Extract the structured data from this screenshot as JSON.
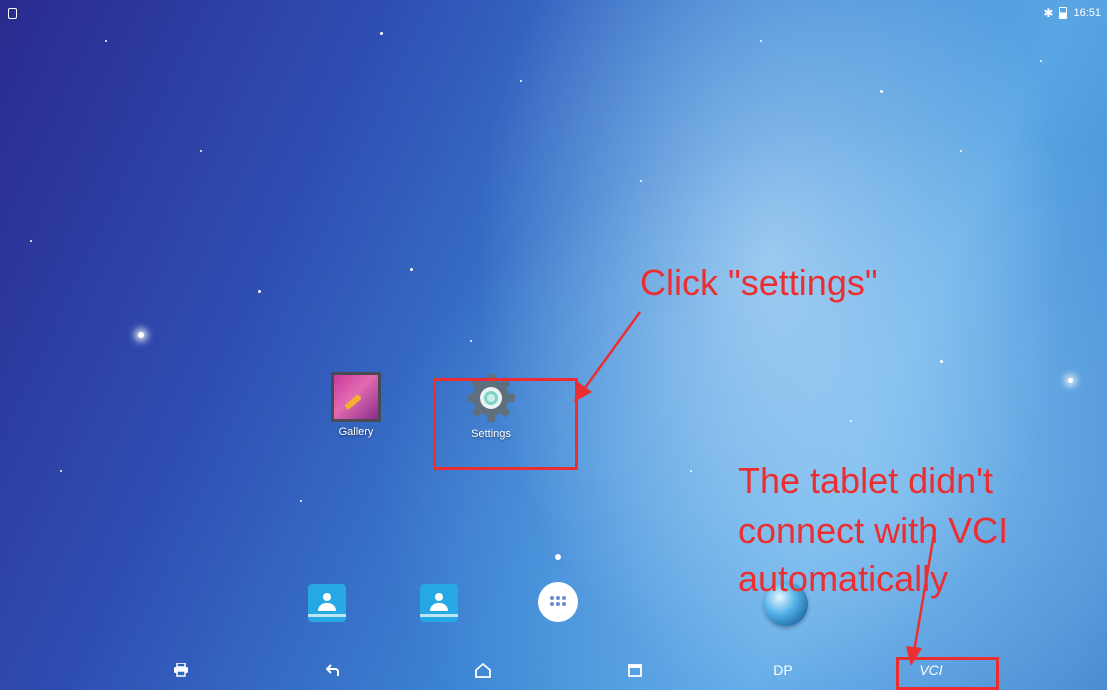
{
  "status_bar": {
    "time": "16:51",
    "bluetooth_icon": "bluetooth-icon",
    "battery_icon": "battery-icon",
    "notification_icon": "notification-icon"
  },
  "home_apps": [
    {
      "label": "Gallery",
      "icon": "gallery-icon"
    },
    {
      "label": "Settings",
      "icon": "gear-icon"
    }
  ],
  "dock": [
    {
      "icon": "contacts-icon"
    },
    {
      "icon": "contacts-icon"
    },
    {
      "icon": "app-drawer-icon"
    },
    {
      "icon": "globe-icon"
    }
  ],
  "navbar": {
    "print_icon": "print-icon",
    "back_icon": "back-icon",
    "home_icon": "home-icon",
    "recents_icon": "recents-icon",
    "dp_label": "DP",
    "vci_label": "VCI"
  },
  "annotations": {
    "click_settings": "Click \"settings\"",
    "vci_note_line1": "The tablet didn't",
    "vci_note_line2": "connect with VCI",
    "vci_note_line3": "automatically",
    "color": "#ec2e31"
  }
}
